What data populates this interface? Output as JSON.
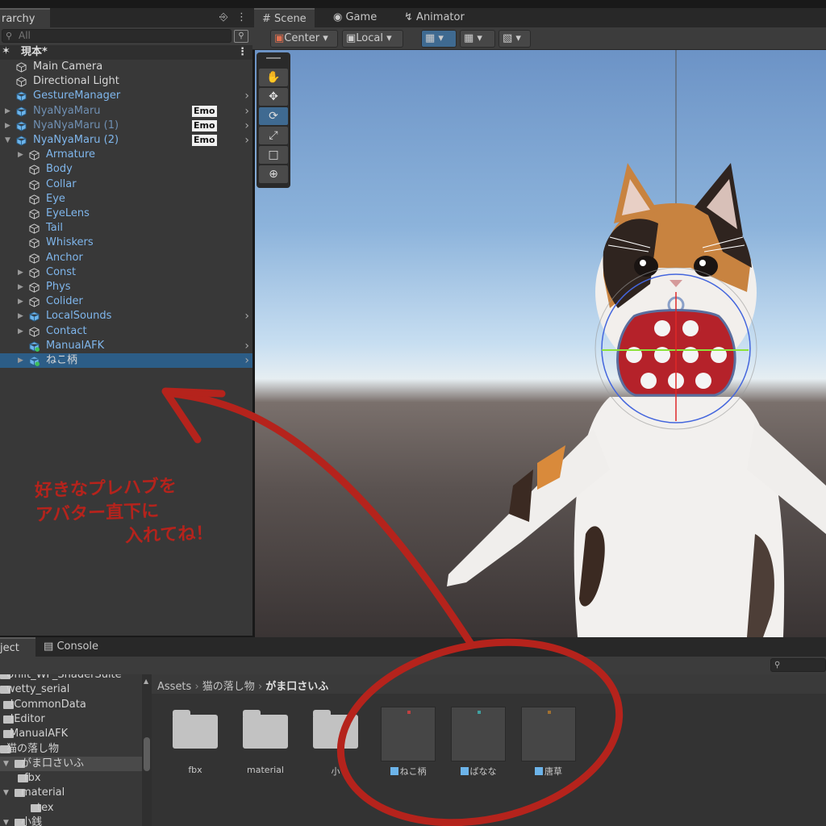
{
  "hierarchy": {
    "tab_label": "rarchy",
    "lock_icon": "lock-icon",
    "more_icon": "more-icon",
    "search_placeholder": "All",
    "scene_name": "現本*",
    "items": [
      {
        "label": "Main Camera"
      },
      {
        "label": "Directional Light"
      },
      {
        "label": "GestureManager"
      },
      {
        "label": "NyaNyaMaru",
        "badge": "Emo"
      },
      {
        "label": "NyaNyaMaru (1)",
        "badge": "Emo"
      },
      {
        "label": "NyaNyaMaru (2)",
        "badge": "Emo"
      },
      {
        "label": "Armature"
      },
      {
        "label": "Body"
      },
      {
        "label": "Collar"
      },
      {
        "label": "Eye"
      },
      {
        "label": "EyeLens"
      },
      {
        "label": "Tail"
      },
      {
        "label": "Whiskers"
      },
      {
        "label": "Anchor"
      },
      {
        "label": "Const"
      },
      {
        "label": "Phys"
      },
      {
        "label": "Colider"
      },
      {
        "label": "LocalSounds"
      },
      {
        "label": "Contact"
      },
      {
        "label": "ManualAFK"
      },
      {
        "label": "ねこ柄"
      }
    ]
  },
  "scene": {
    "tabs": [
      "Scene",
      "Game",
      "Animator"
    ],
    "pivot_label": "Center",
    "space_label": "Local",
    "colors": {
      "selection": "#2c5d87",
      "accent": "#3f6a91",
      "annotation": "#b5231c",
      "prefab_blue": "#6cb4ea"
    }
  },
  "tools": [
    "hand-tool-icon",
    "move-tool-icon",
    "rotate-tool-icon",
    "scale-tool-icon",
    "rect-tool-icon",
    "transform-tool-icon"
  ],
  "project": {
    "tab_label": "ject",
    "console_label": "Console",
    "tree": [
      {
        "label": "Unlit_WF_ShaderSuite"
      },
      {
        "label": "wetty_serial"
      },
      {
        "label": "!CommonData"
      },
      {
        "label": "!Editor"
      },
      {
        "label": "ManualAFK"
      },
      {
        "label": "猫の落し物"
      },
      {
        "label": "がま口さいふ"
      },
      {
        "label": "fbx"
      },
      {
        "label": "material"
      },
      {
        "label": "tex"
      },
      {
        "label": "小銭"
      }
    ],
    "breadcrumb": [
      "Assets",
      "猫の落し物",
      "がま口さいふ"
    ],
    "assets": [
      {
        "name": "fbx",
        "kind": "folder"
      },
      {
        "name": "material",
        "kind": "folder"
      },
      {
        "name": "小",
        "kind": "folder"
      },
      {
        "name": "ねこ柄",
        "kind": "prefab"
      },
      {
        "name": "ばなな",
        "kind": "prefab"
      },
      {
        "name": "唐草",
        "kind": "prefab"
      }
    ]
  },
  "annotation": {
    "lines": [
      "好きなプレハブを",
      "アバター直下に",
      "入れてね！"
    ]
  }
}
